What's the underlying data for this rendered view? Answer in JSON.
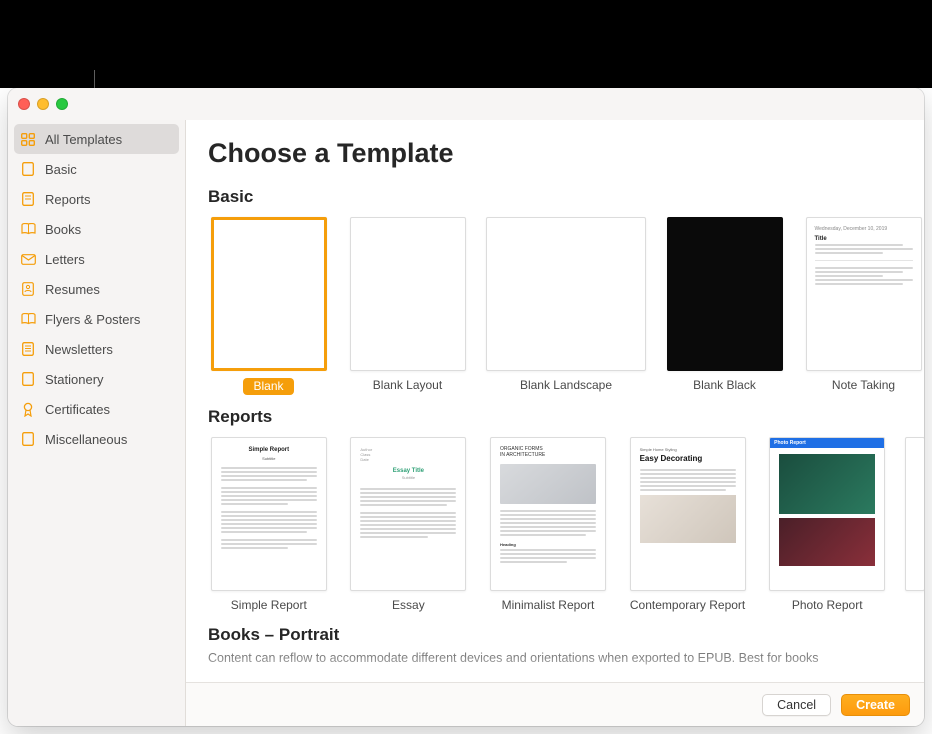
{
  "colors": {
    "accent": "#f59e0b",
    "primary_button": "#fd9b0e"
  },
  "header": {
    "title": "Choose a Template"
  },
  "sidebar": {
    "items": [
      {
        "label": "All Templates",
        "icon": "grid-icon",
        "selected": true
      },
      {
        "label": "Basic",
        "icon": "doc-icon"
      },
      {
        "label": "Reports",
        "icon": "doc-icon"
      },
      {
        "label": "Books",
        "icon": "book-icon"
      },
      {
        "label": "Letters",
        "icon": "envelope-icon"
      },
      {
        "label": "Resumes",
        "icon": "person-doc-icon"
      },
      {
        "label": "Flyers & Posters",
        "icon": "book-icon"
      },
      {
        "label": "Newsletters",
        "icon": "doc-icon"
      },
      {
        "label": "Stationery",
        "icon": "doc-icon"
      },
      {
        "label": "Certificates",
        "icon": "ribbon-icon"
      },
      {
        "label": "Miscellaneous",
        "icon": "doc-icon"
      }
    ]
  },
  "sections": {
    "basic": {
      "title": "Basic",
      "templates": [
        {
          "label": "Blank",
          "selected": true
        },
        {
          "label": "Blank Layout"
        },
        {
          "label": "Blank Landscape"
        },
        {
          "label": "Blank Black"
        },
        {
          "label": "Note Taking"
        }
      ]
    },
    "reports": {
      "title": "Reports",
      "templates": [
        {
          "label": "Simple Report"
        },
        {
          "label": "Essay"
        },
        {
          "label": "Minimalist Report"
        },
        {
          "label": "Contemporary Report"
        },
        {
          "label": "Photo Report"
        }
      ]
    },
    "books": {
      "title": "Books – Portrait",
      "subtitle": "Content can reflow to accommodate different devices and orientations when exported to EPUB. Best for books"
    }
  },
  "thumb_text": {
    "simple_report_title": "Simple Report",
    "simple_report_sub": "Subtitle",
    "essay_title": "Essay Title",
    "essay_sub": "Subtitle",
    "minimalist_head1": "ORGANIC FORMS",
    "minimalist_head2": "IN ARCHITECTURE",
    "contemp_kicker": "Simple Home Styling",
    "contemp_title": "Easy Decorating",
    "photo_band": "Photo Report",
    "note_left": "Wednesday, December 10, 2019",
    "note_title": "Title"
  },
  "footer": {
    "cancel": "Cancel",
    "create": "Create"
  }
}
